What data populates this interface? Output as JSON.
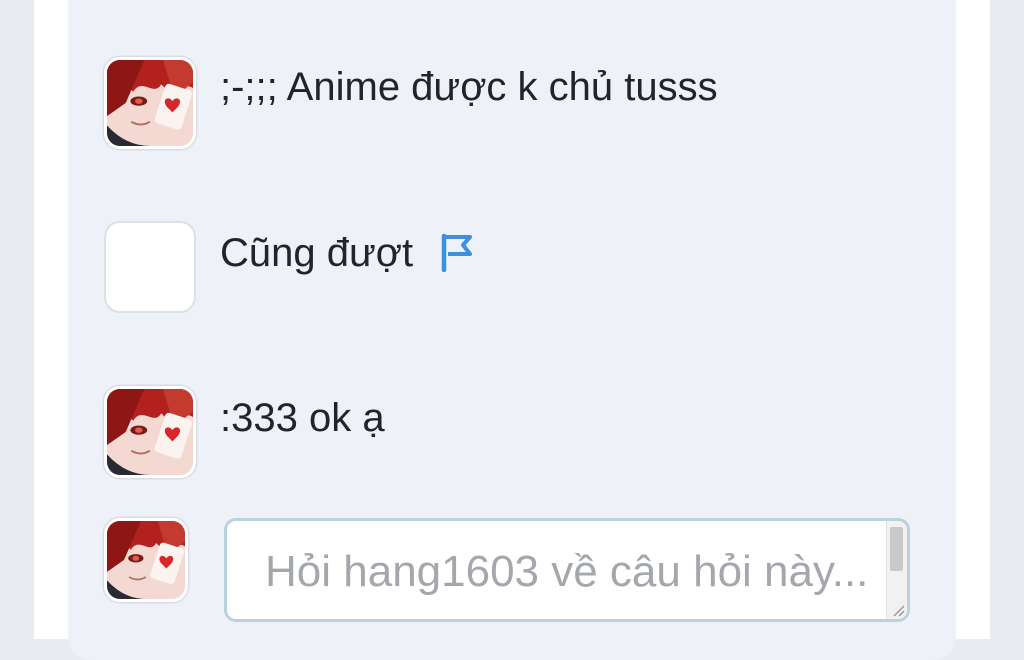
{
  "comments": [
    {
      "text": ";-;;; Anime được k chủ tusss",
      "avatar": "anime-red-hair-avatar"
    },
    {
      "text": "Cũng đượt",
      "avatar": "blank-avatar",
      "flag_icon": "flag-icon"
    },
    {
      "text": ":333 ok ạ",
      "avatar": "anime-red-hair-avatar"
    }
  ],
  "ask": {
    "avatar": "anime-red-hair-avatar",
    "placeholder": "Hỏi hang1603 về câu hỏi này..."
  },
  "colors": {
    "panel": "#eef2f8",
    "flag": "#3d8fe0",
    "input_border": "#b9d3dd",
    "text": "#222428",
    "placeholder": "#a4a8ad"
  }
}
